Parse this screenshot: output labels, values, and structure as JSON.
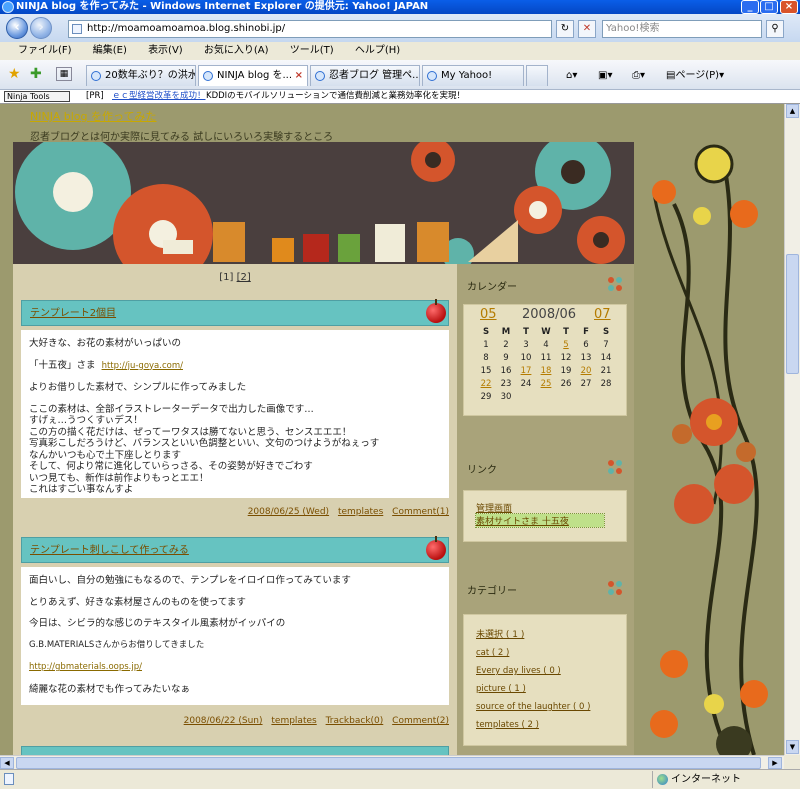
{
  "window": {
    "title": "NINJA blog を作ってみた - Windows Internet Explorer の提供元: Yahoo! JAPAN",
    "buttons": {
      "minimize": "_",
      "maximize": "□",
      "close": "×"
    }
  },
  "address": {
    "url": "http://moamoamoamoa.blog.shinobi.jp/",
    "search_placeholder": "Yahoo!検索"
  },
  "menu": [
    "ファイル(F)",
    "編集(E)",
    "表示(V)",
    "お気に入り(A)",
    "ツール(T)",
    "ヘルプ(H)"
  ],
  "tabs": [
    {
      "label": "20数年ぶり？の洪水..."
    },
    {
      "label": "NINJA blog を..."
    },
    {
      "label": "忍者ブログ 管理ペ..."
    },
    {
      "label": "My Yahoo!"
    }
  ],
  "toolbar_right": {
    "page_label": "ページ(P)"
  },
  "ninja_bar": {
    "logo": "Ninja Tools",
    "pr": "[PR]",
    "pr_link": "ｅｃ型経営改革を成功！",
    "pr_text": "KDDIのモバイルソリューションで通信費削減と業務効率化を実現！"
  },
  "blog": {
    "title": "NINJA blog を作ってみた",
    "subtitle": "忍者ブログとは何か実際に見てみる 試しにいろいろ実験するところ",
    "pager": {
      "p1": "[1]",
      "p2": "[2]"
    },
    "posts": [
      {
        "title": "テンプレート2個目",
        "body": [
          "大好きな、お花の素材がいっぱいの",
          "「十五夜」さま",
          "http://ju-goya.com/",
          "よりお借りした素材で、シンプルに作ってみました",
          "ここの素材は、全部イラストレーターデータで出力した画像です…\nすげぇ…うつくすぃデス！\nこの方の描く花だけは、ぜってーワタスは勝てないと思う、センスエエエ！\n写真彩こしだろうけど、バランスといい色調整といい、文句のつけようがねぇっす\nなんかいつも心で土下座しとります\nそして、何より常に進化していらっさる、その姿勢が好きでごわす\nいつ見ても、新作は前作よりもっとエエ！\nこれはすごい事なんすよ"
        ],
        "meta": {
          "date": "2008/06/25 (Wed)",
          "category": "templates",
          "comment": "Comment(1)"
        }
      },
      {
        "title": "テンプレート刺しこして作ってみる",
        "body": [
          "面白いし、自分の勉強にもなるので、テンプレをイロイロ作ってみています",
          "とりあえず、好きな素材屋さんのものを使ってます",
          "今日は、シビラ的な感じのテキスタイル風素材がイッパイの",
          "G.B.MATERIALSさんからお借りしてきました",
          "http://gbmaterials.oops.jp/",
          "綺麗な花の素材でも作ってみたいなぁ"
        ],
        "meta": {
          "date": "2008/06/22 (Sun)",
          "category": "templates",
          "trackback": "Trackback(0)",
          "comment": "Comment(2)"
        }
      }
    ]
  },
  "sidebar": {
    "calendar": {
      "heading": "カレンダー",
      "prev": "05",
      "month": "2008/06",
      "next": "07",
      "weekdays": [
        "S",
        "M",
        "T",
        "W",
        "T",
        "F",
        "S"
      ],
      "weeks": [
        [
          "1",
          "2",
          "3",
          "4",
          "5",
          "6",
          "7"
        ],
        [
          "8",
          "9",
          "10",
          "11",
          "12",
          "13",
          "14"
        ],
        [
          "15",
          "16",
          "17",
          "18",
          "19",
          "20",
          "21"
        ],
        [
          "22",
          "23",
          "24",
          "25",
          "26",
          "27",
          "28"
        ],
        [
          "29",
          "30",
          "",
          "",
          "",
          "",
          ""
        ]
      ],
      "linked_days": [
        "5",
        "17",
        "18",
        "20",
        "22",
        "25"
      ]
    },
    "links": {
      "heading": "リンク",
      "items": [
        "管理画面",
        "素材サイトさま 十五夜"
      ]
    },
    "categories": {
      "heading": "カテゴリー",
      "items": [
        "未選択 ( 1 )",
        "cat ( 2 )",
        "Every day lives ( 0 )",
        "picture ( 1 )",
        "source of the laughter ( 0 )",
        "templates ( 2 )"
      ]
    }
  },
  "status": {
    "zone": "インターネット"
  },
  "colors": {
    "page_bg": "#9c9a6e",
    "post_header": "#66c3c1",
    "link": "#b47b00"
  }
}
